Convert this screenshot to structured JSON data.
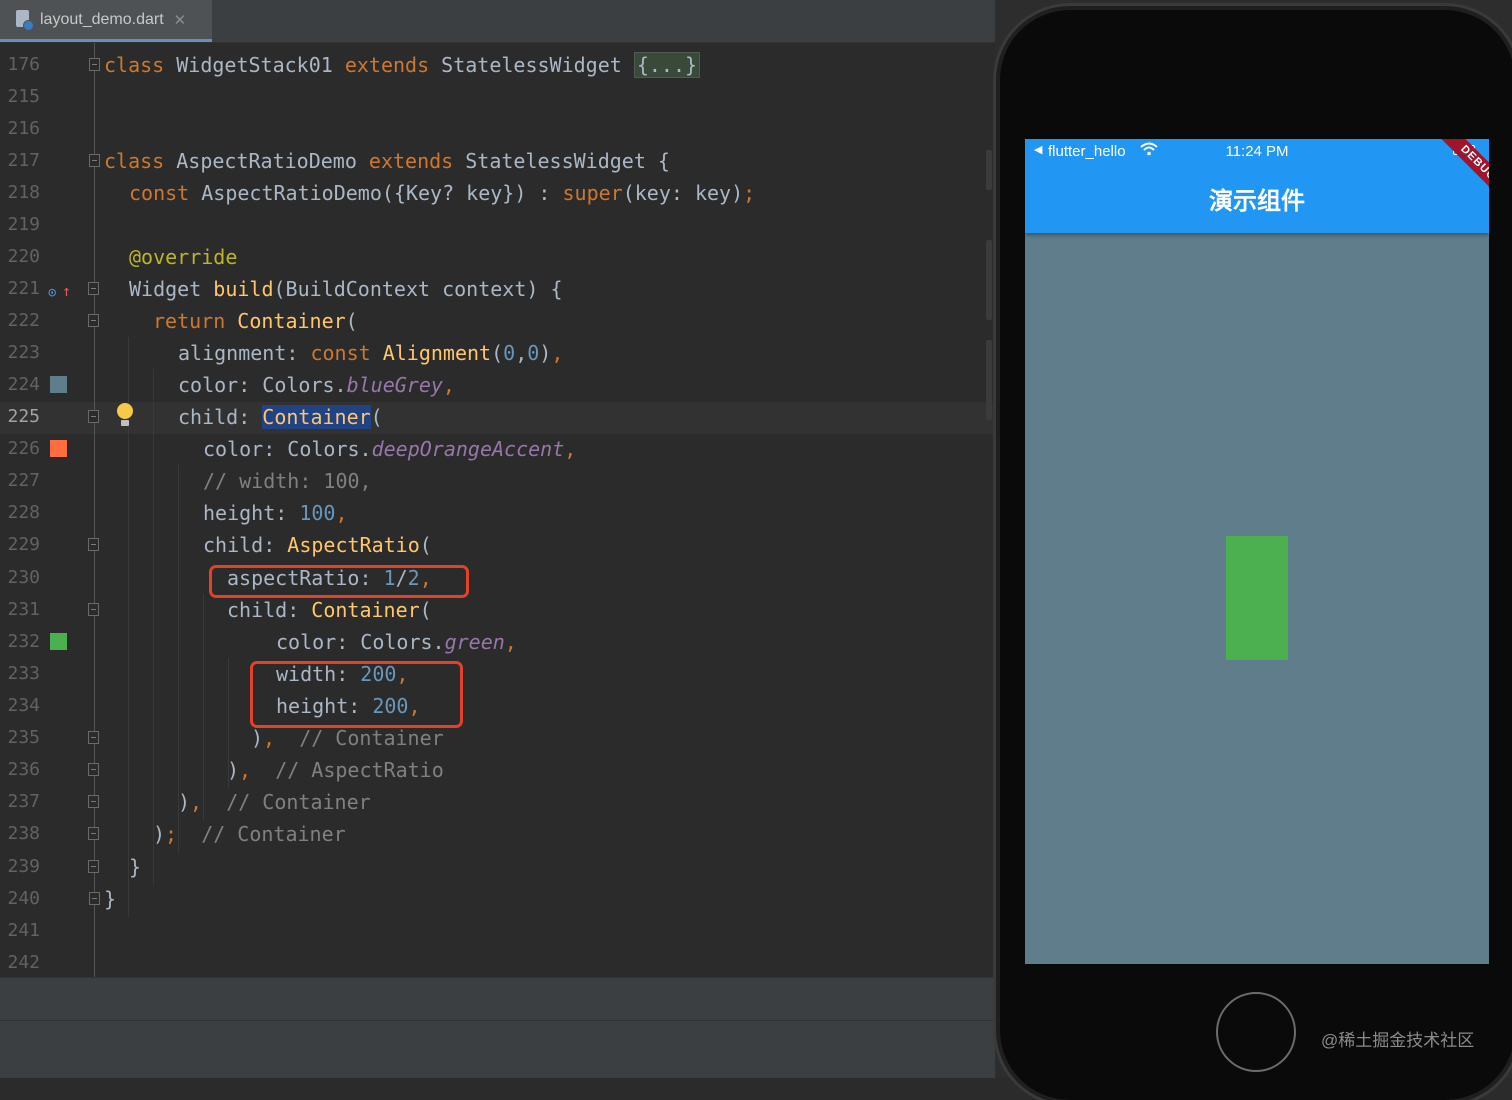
{
  "tab": {
    "filename": "layout_demo.dart",
    "close": "✕"
  },
  "editor": {
    "lines": [
      {
        "num": "176",
        "text": "class WidgetStack01 extends StatelessWidget {...}"
      },
      {
        "num": "215",
        "text": ""
      },
      {
        "num": "216",
        "text": ""
      },
      {
        "num": "217",
        "text": "class AspectRatioDemo extends StatelessWidget {"
      },
      {
        "num": "218",
        "text": "const AspectRatioDemo({Key? key}) : super(key: key);"
      },
      {
        "num": "219",
        "text": ""
      },
      {
        "num": "220",
        "text": "@override"
      },
      {
        "num": "221",
        "text": "Widget build(BuildContext context) {"
      },
      {
        "num": "222",
        "text": "return Container("
      },
      {
        "num": "223",
        "text": "alignment: const Alignment(0,0),"
      },
      {
        "num": "224",
        "text": "color: Colors.blueGrey,"
      },
      {
        "num": "225",
        "text": "child: Container("
      },
      {
        "num": "226",
        "text": "color: Colors.deepOrangeAccent,"
      },
      {
        "num": "227",
        "text": "// width: 100,"
      },
      {
        "num": "228",
        "text": "height: 100,"
      },
      {
        "num": "229",
        "text": "child: AspectRatio("
      },
      {
        "num": "230",
        "text": "aspectRatio: 1/2,"
      },
      {
        "num": "231",
        "text": "child: Container("
      },
      {
        "num": "232",
        "text": "color: Colors.green,"
      },
      {
        "num": "233",
        "text": "width: 200,"
      },
      {
        "num": "234",
        "text": "height: 200,"
      },
      {
        "num": "235",
        "text": "), // Container"
      },
      {
        "num": "236",
        "text": "), // AspectRatio"
      },
      {
        "num": "237",
        "text": "), // Container"
      },
      {
        "num": "238",
        "text": "); // Container"
      },
      {
        "num": "239",
        "text": "}"
      },
      {
        "num": "240",
        "text": "}"
      },
      {
        "num": "241",
        "text": ""
      },
      {
        "num": "242",
        "text": ""
      }
    ],
    "current_line": "225",
    "swatch_colors": {
      "blueGrey": "#607d8b",
      "deepOrangeAccent": "#ff6e40",
      "green": "#4caf50"
    }
  },
  "simulator": {
    "status": {
      "app": "flutter_hello",
      "time": "11:24 PM"
    },
    "appbar_title": "演示组件",
    "debug_banner": "DEBUG",
    "colors": {
      "appbar": "#2196f3",
      "background": "#607d8b",
      "box": "#4caf50"
    }
  },
  "watermark": "@稀土掘金技术社区"
}
